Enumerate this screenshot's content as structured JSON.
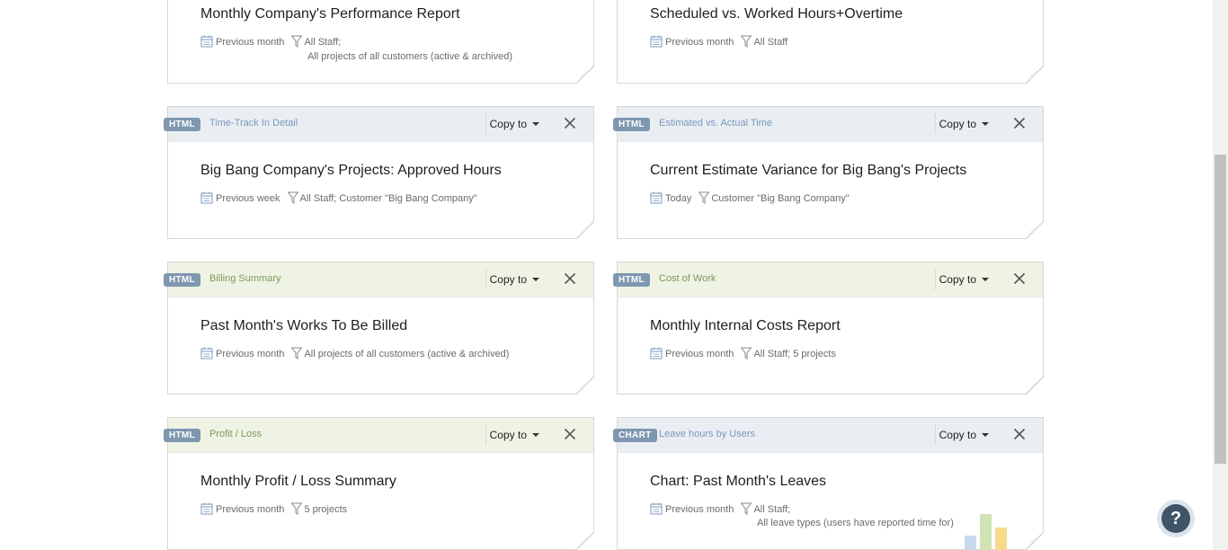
{
  "common": {
    "copy_label": "Copy to"
  },
  "cards": [
    {
      "title": "Monthly Company's Performance Report",
      "date": "Previous month",
      "filter": "All Staff;",
      "filter2": "All projects of all customers (active & archived)"
    },
    {
      "title": "Scheduled vs. Worked Hours+Overtime",
      "date": "Previous month",
      "filter": "All Staff"
    },
    {
      "badge": "HTML",
      "type": "Time-Track In Detail",
      "title": "Big Bang Company's Projects: Approved Hours",
      "date": "Previous week",
      "filter": "All Staff; Customer \"Big Bang Company\""
    },
    {
      "badge": "HTML",
      "type": "Estimated vs. Actual Time",
      "title": "Current Estimate Variance for Big Bang's Projects",
      "date": "Today",
      "filter": "Customer \"Big Bang Company\""
    },
    {
      "badge": "HTML",
      "type": "Billing Summary",
      "title": "Past Month's Works To Be Billed",
      "date": "Previous month",
      "filter": "All projects of all customers (active & archived)"
    },
    {
      "badge": "HTML",
      "type": "Cost of Work",
      "title": "Monthly Internal Costs Report",
      "date": "Previous month",
      "filter": "All Staff; 5 projects"
    },
    {
      "badge": "HTML",
      "type": "Profit / Loss",
      "title": "Monthly Profit / Loss Summary",
      "date": "Previous month",
      "filter": "5 projects"
    },
    {
      "badge": "CHART",
      "type": "Leave hours by Users",
      "title": "Chart: Past Month's Leaves",
      "date": "Previous month",
      "filter": "All Staff;",
      "filter2": "All leave types (users have reported time for)"
    }
  ],
  "colors": {
    "header_blue": "#e9eef3",
    "header_green": "#eef3e4",
    "badge": "#7f97b0",
    "help_button": "#3f5467"
  },
  "help": {
    "label": "?"
  }
}
